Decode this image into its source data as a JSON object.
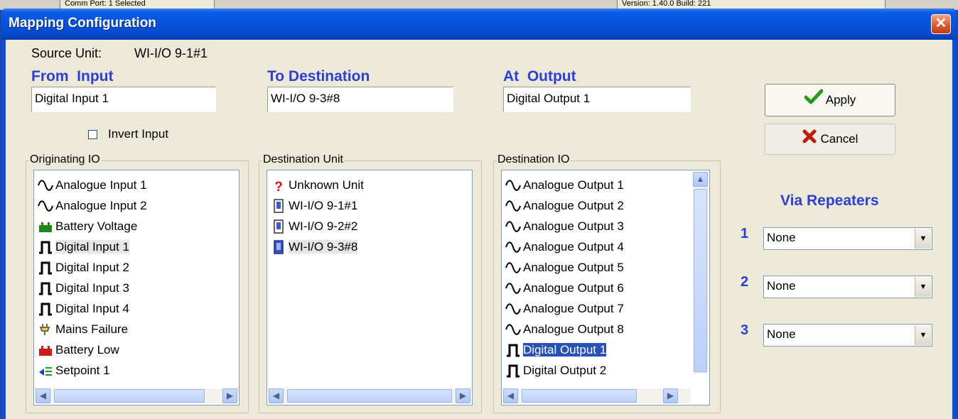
{
  "background_status": {
    "left_text": "Comm Port: 1 Selected",
    "right_text": "Version: 1.40.0 Build: 221"
  },
  "dialog": {
    "title": "Mapping Configuration",
    "close_symbol": "✕"
  },
  "source_unit": {
    "label": "Source Unit:",
    "value": "WI-I/O 9-1#1"
  },
  "from_input": {
    "header": "From  Input",
    "value": "Digital Input 1",
    "invert_label": "Invert Input",
    "invert_checked": false
  },
  "to_destination": {
    "header": "To Destination",
    "value": "WI-I/O 9-3#8"
  },
  "at_output": {
    "header": "At  Output",
    "value": "Digital Output 1"
  },
  "originating_io": {
    "title": "Originating IO",
    "items": [
      {
        "icon": "sine-wave-icon",
        "label": "Analogue Input 1"
      },
      {
        "icon": "sine-wave-icon",
        "label": "Analogue Input 2"
      },
      {
        "icon": "battery-green-icon",
        "label": "Battery Voltage"
      },
      {
        "icon": "square-pulse-icon",
        "label": "Digital Input 1",
        "selected": true
      },
      {
        "icon": "square-pulse-icon",
        "label": "Digital Input 2"
      },
      {
        "icon": "square-pulse-icon",
        "label": "Digital Input 3"
      },
      {
        "icon": "square-pulse-icon",
        "label": "Digital Input 4"
      },
      {
        "icon": "plug-icon",
        "label": "Mains Failure"
      },
      {
        "icon": "battery-red-icon",
        "label": "Battery Low"
      },
      {
        "icon": "setpoint-icon",
        "label": "Setpoint 1"
      }
    ]
  },
  "destination_unit": {
    "title": "Destination Unit",
    "items": [
      {
        "icon": "question-icon",
        "label": "Unknown Unit"
      },
      {
        "icon": "device-icon",
        "label": "WI-I/O 9-1#1"
      },
      {
        "icon": "device-icon",
        "label": "WI-I/O 9-2#2"
      },
      {
        "icon": "device-selected-icon",
        "label": "WI-I/O 9-3#8",
        "selected": true
      }
    ]
  },
  "destination_io": {
    "title": "Destination IO",
    "items": [
      {
        "icon": "sine-wave-icon",
        "label": "Analogue Output 1"
      },
      {
        "icon": "sine-wave-icon",
        "label": "Analogue Output 2"
      },
      {
        "icon": "sine-wave-icon",
        "label": "Analogue Output 3"
      },
      {
        "icon": "sine-wave-icon",
        "label": "Analogue Output 4"
      },
      {
        "icon": "sine-wave-icon",
        "label": "Analogue Output 5"
      },
      {
        "icon": "sine-wave-icon",
        "label": "Analogue Output 6"
      },
      {
        "icon": "sine-wave-icon",
        "label": "Analogue Output 7"
      },
      {
        "icon": "sine-wave-icon",
        "label": "Analogue Output 8"
      },
      {
        "icon": "square-pulse-icon",
        "label": "Digital Output 1",
        "selected": true
      },
      {
        "icon": "square-pulse-icon",
        "label": "Digital Output 2"
      }
    ]
  },
  "buttons": {
    "apply": "Apply",
    "cancel": "Cancel"
  },
  "repeaters": {
    "header": "Via Repeaters",
    "rows": [
      {
        "num": "1",
        "value": "None"
      },
      {
        "num": "2",
        "value": "None"
      },
      {
        "num": "3",
        "value": "None"
      }
    ]
  },
  "colors": {
    "title_bar": "#0552dc",
    "header_text": "#2b3fd6",
    "dialog_bg": "#ece9d8",
    "selection": "#2750b8"
  }
}
